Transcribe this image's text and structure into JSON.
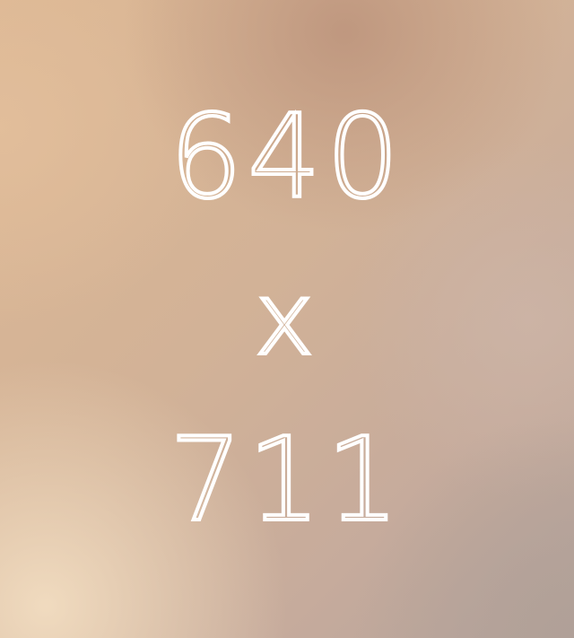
{
  "placeholder": {
    "width_text": "640",
    "separator_text": "x",
    "height_text": "711",
    "text_color": "#ffffff",
    "background_colors": [
      "#ddb894",
      "#c6ab9c",
      "#f2ddc1",
      "#b0a098"
    ]
  }
}
